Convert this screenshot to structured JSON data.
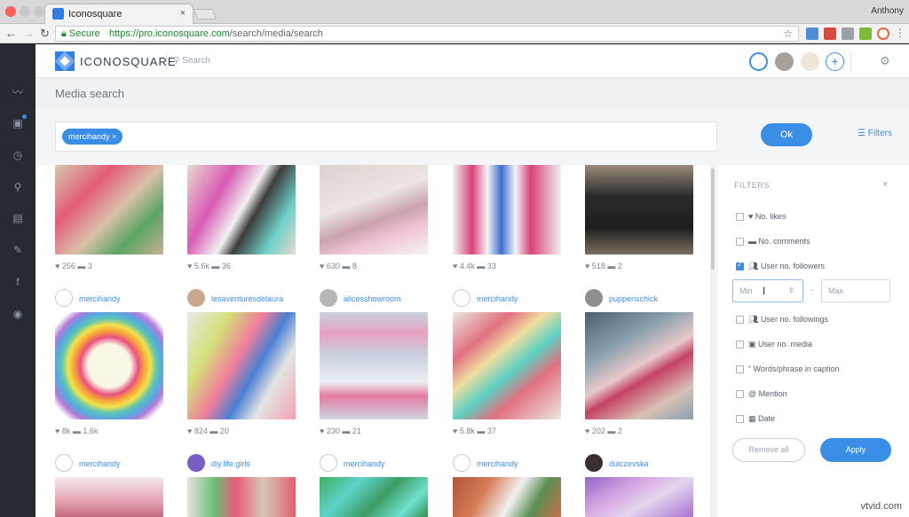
{
  "browser": {
    "tab_title": "Iconosquare",
    "tab_close": "×",
    "user": "Anthony",
    "secure_label": "Secure",
    "url_host": "https://pro.iconosquare.com",
    "url_path": "/search/media/search"
  },
  "header": {
    "logo_text": "ICONOSQUARE",
    "search_placeholder": "Search"
  },
  "page": {
    "title": "Media search"
  },
  "search": {
    "chip": "mercihandy",
    "chip_remove": "×",
    "ok": "Ok",
    "filters": "Filters"
  },
  "row1": [
    {
      "likes": "256",
      "comments": "3"
    },
    {
      "likes": "5.6k",
      "comments": "36"
    },
    {
      "likes": "630",
      "comments": "8"
    },
    {
      "likes": "4.4k",
      "comments": "33"
    },
    {
      "likes": "518",
      "comments": "2"
    }
  ],
  "row2": [
    {
      "user": "mercihandy",
      "likes": "8k",
      "comments": "1.6k"
    },
    {
      "user": "lesaventuresdelaura",
      "likes": "824",
      "comments": "20"
    },
    {
      "user": "alicesshowroom",
      "likes": "230",
      "comments": "21"
    },
    {
      "user": "mercihandy",
      "likes": "5.8k",
      "comments": "37"
    },
    {
      "user": "puppenschick",
      "likes": "202",
      "comments": "2"
    }
  ],
  "row3": [
    {
      "user": "mercihandy"
    },
    {
      "user": "diy.life.girls"
    },
    {
      "user": "mercihandy"
    },
    {
      "user": "mercihandy"
    },
    {
      "user": "dulczevska"
    }
  ],
  "filters": {
    "title": "FILTERS",
    "close": "×",
    "items": [
      {
        "label": "No. likes",
        "checked": false
      },
      {
        "label": "No. comments",
        "checked": false
      },
      {
        "label": "User no. followers",
        "checked": true
      },
      {
        "label": "User no. followings",
        "checked": false
      },
      {
        "label": "User no. media",
        "checked": false
      },
      {
        "label": "Words/phrase in caption",
        "checked": false
      },
      {
        "label": "Mention",
        "checked": false
      },
      {
        "label": "Date",
        "checked": false
      }
    ],
    "min_placeholder": "Min",
    "dash": "-",
    "max_placeholder": "Max",
    "remove_all": "Remove all",
    "apply": "Apply"
  },
  "watermark": "vtvid.com"
}
